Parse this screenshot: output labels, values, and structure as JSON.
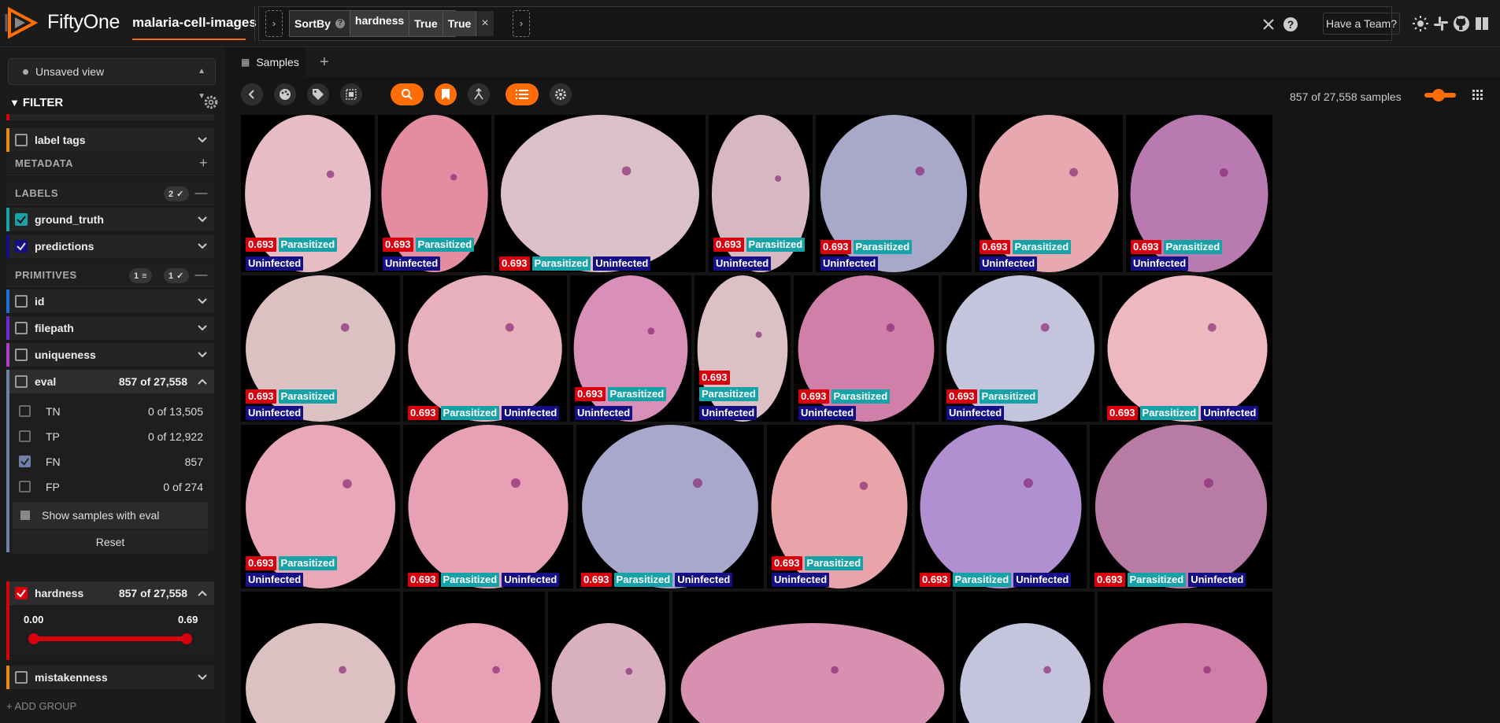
{
  "header": {
    "brand": "FiftyOne",
    "dataset": "malaria-cell-images",
    "stage": {
      "name": "SortBy",
      "help": "?",
      "field": "hardness",
      "arg1": "True",
      "arg2": "True",
      "close": "×"
    },
    "team": "Have a Team?"
  },
  "sidebar": {
    "view": "Unsaved view",
    "filter_title": "FILTER",
    "label_tags": "label tags",
    "metadata": "METADATA",
    "labels_section": "LABELS",
    "labels_count": "2",
    "ground_truth": "ground_truth",
    "predictions": "predictions",
    "primitives_section": "PRIMITIVES",
    "prim_count1": "1",
    "prim_count2": "1",
    "id": "id",
    "filepath": "filepath",
    "uniqueness": "uniqueness",
    "eval": {
      "label": "eval",
      "count": "857 of 27,558",
      "values": [
        {
          "name": "TN",
          "count": "0 of 13,505",
          "checked": false
        },
        {
          "name": "TP",
          "count": "0 of 12,922",
          "checked": false
        },
        {
          "name": "FN",
          "count": "857",
          "checked": true
        },
        {
          "name": "FP",
          "count": "0 of 274",
          "checked": false
        }
      ],
      "show": "Show samples with eval",
      "reset": "Reset"
    },
    "hardness": {
      "label": "hardness",
      "count": "857 of 27,558",
      "min": "0.00",
      "max": "0.69"
    },
    "mistakenness": "mistakenness",
    "add_group": "+ ADD GROUP"
  },
  "main": {
    "tab": "Samples",
    "count": "857 of 27,558 samples"
  },
  "labels": {
    "conf": "0.693",
    "parasitized": "Parasitized",
    "uninfected": "Uninfected"
  },
  "colors": {
    "accent": "#ff6d04",
    "confidence": "#d9000d",
    "parasitized": "#17a2a8",
    "uninfected": "#150f86",
    "ground_truth": "#17a2a8",
    "predictions": "#150f86"
  },
  "icons": [
    "fiftyone-logo",
    "help-icon",
    "close-icon",
    "sun-icon",
    "slack-icon",
    "github-icon",
    "chevron-down-icon",
    "chevron-up-icon",
    "gear-icon",
    "back-icon",
    "palette-icon",
    "tag-icon",
    "select-icon",
    "search-icon",
    "bookmark-icon",
    "merge-icon",
    "list-icon",
    "grid-icon"
  ]
}
